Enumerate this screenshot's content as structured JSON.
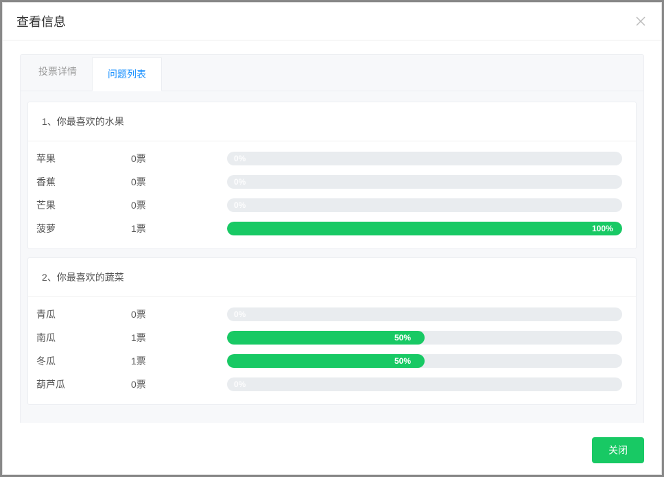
{
  "modal": {
    "title": "查看信息",
    "close_label": "关闭"
  },
  "tabs": [
    {
      "label": "投票详情",
      "active": false
    },
    {
      "label": "问题列表",
      "active": true
    }
  ],
  "vote_unit": "票",
  "questions": [
    {
      "index": "1",
      "title": "你最喜欢的水果",
      "options": [
        {
          "name": "苹果",
          "votes": 0,
          "percent": 0,
          "percent_label": "0%"
        },
        {
          "name": "香蕉",
          "votes": 0,
          "percent": 0,
          "percent_label": "0%"
        },
        {
          "name": "芒果",
          "votes": 0,
          "percent": 0,
          "percent_label": "0%"
        },
        {
          "name": "菠萝",
          "votes": 1,
          "percent": 100,
          "percent_label": "100%"
        }
      ]
    },
    {
      "index": "2",
      "title": "你最喜欢的蔬菜",
      "options": [
        {
          "name": "青瓜",
          "votes": 0,
          "percent": 0,
          "percent_label": "0%"
        },
        {
          "name": "南瓜",
          "votes": 1,
          "percent": 50,
          "percent_label": "50%"
        },
        {
          "name": "冬瓜",
          "votes": 1,
          "percent": 50,
          "percent_label": "50%"
        },
        {
          "name": "葫芦瓜",
          "votes": 0,
          "percent": 0,
          "percent_label": "0%"
        }
      ]
    }
  ],
  "colors": {
    "accent_green": "#18c964",
    "bar_bg": "#e9ecef",
    "tab_active": "#1890ff"
  }
}
